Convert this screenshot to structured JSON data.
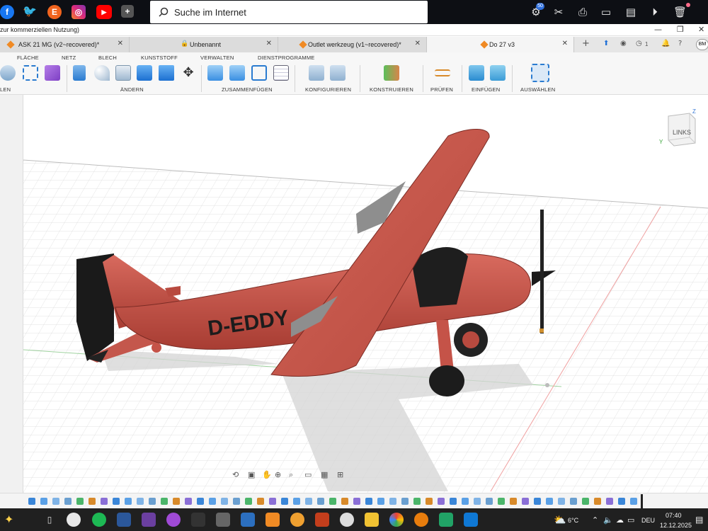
{
  "browser": {
    "search_placeholder": "Suche im Internet",
    "social_icons": [
      "facebook-icon",
      "twitter-icon",
      "etsy-icon",
      "instagram-icon",
      "youtube-icon",
      "add-icon"
    ],
    "toolbar_badge": "50"
  },
  "window": {
    "title_fragment": "zur kommerziellen Nutzung)"
  },
  "tabs": [
    {
      "label": "ASK 21 MG (v2~recovered)*",
      "active": false
    },
    {
      "label": "Unbenannt",
      "active": false
    },
    {
      "label": "Outlet werkzeug (v1~recovered)*",
      "active": false
    },
    {
      "label": "Do 27 v3",
      "active": true
    }
  ],
  "tab_bar": {
    "notifications_count": "1",
    "user_initials": "BM"
  },
  "ribbon": {
    "tabs": [
      "FLÄCHE",
      "NETZ",
      "BLECH",
      "KUNSTSTOFF",
      "VERWALTEN",
      "DIENSTPROGRAMME"
    ],
    "groups": [
      "LEN",
      "ÄNDERN",
      "ZUSAMMENFÜGEN",
      "KONFIGURIEREN",
      "KONSTRUIEREN",
      "PRÜFEN",
      "EINFÜGEN",
      "AUSWÄHLEN"
    ]
  },
  "viewport": {
    "viewcube_label": "LINKS",
    "axis_labels": {
      "z": "Z",
      "y": "Y"
    },
    "model_registration": "D-EDDY",
    "colors": {
      "fuselage": "#c9544a",
      "canopy": "#2a2a2a",
      "wheel": "#222222",
      "grid": "#d0d0d0"
    }
  },
  "taskbar": {
    "weather_temp": "6°C",
    "language": "DEU",
    "time": "07:40",
    "date": "12.12.2025"
  }
}
